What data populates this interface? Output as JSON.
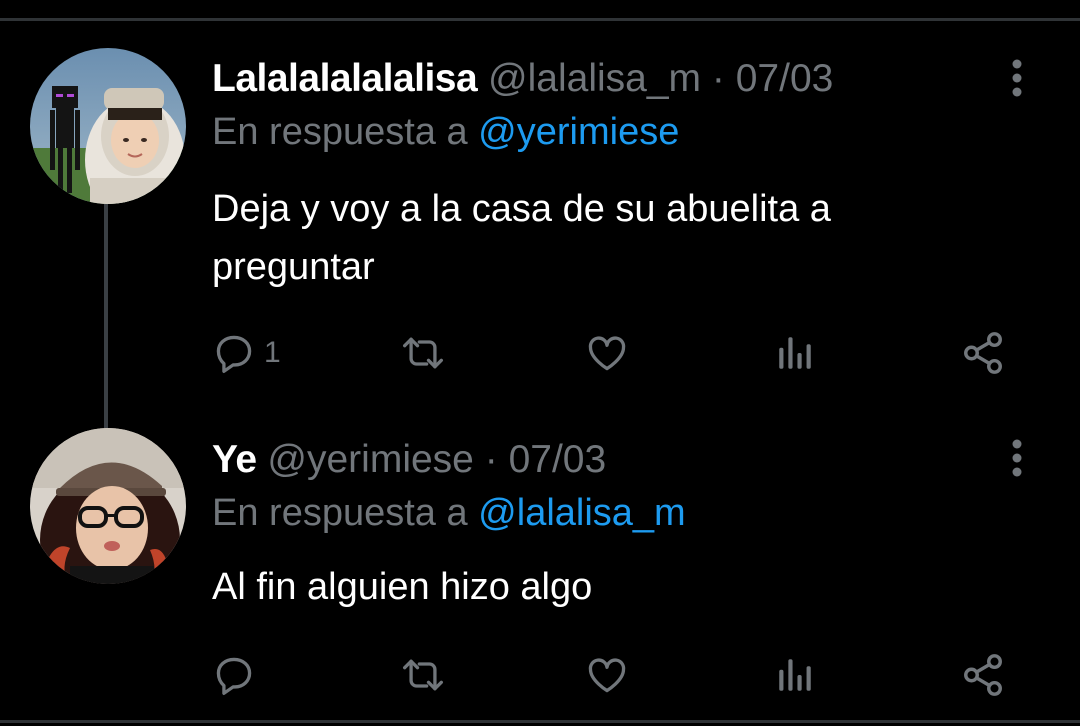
{
  "tweets": [
    {
      "display_name": "Lalalalalalalisa",
      "handle": "@lalalisa_m",
      "separator": "·",
      "date": "07/03",
      "reply_prefix": "En respuesta a",
      "reply_to": "@yerimiese",
      "text": "Deja y voy a la casa de su abuelita a preguntar",
      "reply_count": "1",
      "icons": [
        "reply-icon",
        "retweet-icon",
        "like-icon",
        "views-icon",
        "share-icon",
        "more-icon"
      ]
    },
    {
      "display_name": "Ye",
      "handle": "@yerimiese",
      "separator": "·",
      "date": "07/03",
      "reply_prefix": "En respuesta a",
      "reply_to": "@lalalisa_m",
      "text": "Al fin alguien hizo algo",
      "reply_count": "",
      "icons": [
        "reply-icon",
        "retweet-icon",
        "like-icon",
        "views-icon",
        "share-icon",
        "more-icon"
      ]
    }
  ],
  "colors": {
    "background": "#000000",
    "text": "#ffffff",
    "secondary": "#71767b",
    "link": "#1d9bf0",
    "divider": "#2f3336"
  }
}
